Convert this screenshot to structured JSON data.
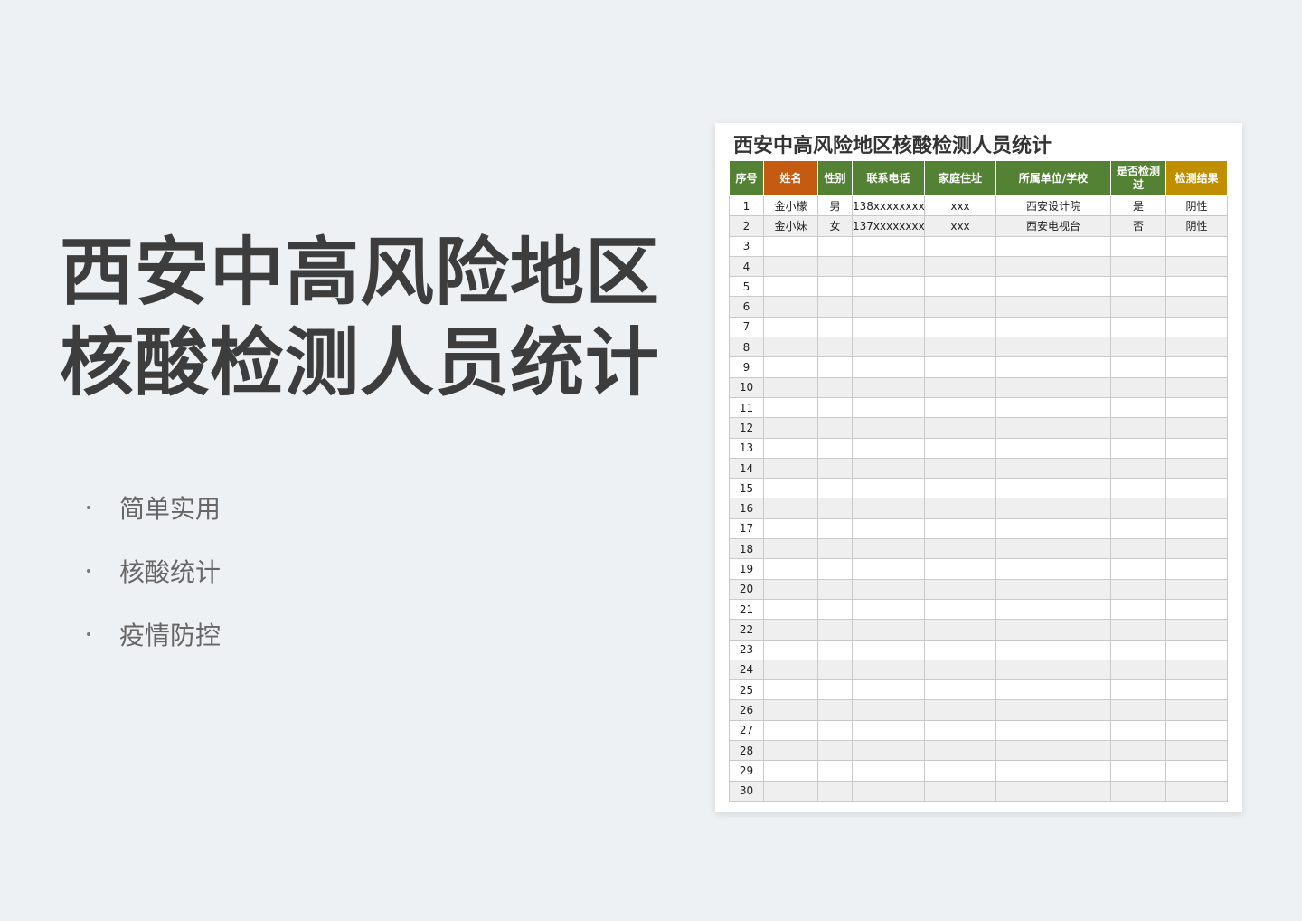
{
  "hero": {
    "line1": "西安中高风险地区",
    "line2": "核酸检测人员统计"
  },
  "features": [
    "简单实用",
    "核酸统计",
    "疫情防控"
  ],
  "sheet": {
    "title": "西安中高风险地区核酸检测人员统计",
    "headers": [
      "序号",
      "姓名",
      "性别",
      "联系电话",
      "家庭住址",
      "所属单位/学校",
      "是否检测过",
      "检测结果"
    ],
    "rows": [
      [
        "1",
        "金小檬",
        "男",
        "138xxxxxxxx",
        "xxx",
        "西安设计院",
        "是",
        "阴性"
      ],
      [
        "2",
        "金小妹",
        "女",
        "137xxxxxxxx",
        "xxx",
        "西安电视台",
        "否",
        "阴性"
      ],
      [
        "3",
        "",
        "",
        "",
        "",
        "",
        "",
        ""
      ],
      [
        "4",
        "",
        "",
        "",
        "",
        "",
        "",
        ""
      ],
      [
        "5",
        "",
        "",
        "",
        "",
        "",
        "",
        ""
      ],
      [
        "6",
        "",
        "",
        "",
        "",
        "",
        "",
        ""
      ],
      [
        "7",
        "",
        "",
        "",
        "",
        "",
        "",
        ""
      ],
      [
        "8",
        "",
        "",
        "",
        "",
        "",
        "",
        ""
      ],
      [
        "9",
        "",
        "",
        "",
        "",
        "",
        "",
        ""
      ],
      [
        "10",
        "",
        "",
        "",
        "",
        "",
        "",
        ""
      ],
      [
        "11",
        "",
        "",
        "",
        "",
        "",
        "",
        ""
      ],
      [
        "12",
        "",
        "",
        "",
        "",
        "",
        "",
        ""
      ],
      [
        "13",
        "",
        "",
        "",
        "",
        "",
        "",
        ""
      ],
      [
        "14",
        "",
        "",
        "",
        "",
        "",
        "",
        ""
      ],
      [
        "15",
        "",
        "",
        "",
        "",
        "",
        "",
        ""
      ],
      [
        "16",
        "",
        "",
        "",
        "",
        "",
        "",
        ""
      ],
      [
        "17",
        "",
        "",
        "",
        "",
        "",
        "",
        ""
      ],
      [
        "18",
        "",
        "",
        "",
        "",
        "",
        "",
        ""
      ],
      [
        "19",
        "",
        "",
        "",
        "",
        "",
        "",
        ""
      ],
      [
        "20",
        "",
        "",
        "",
        "",
        "",
        "",
        ""
      ],
      [
        "21",
        "",
        "",
        "",
        "",
        "",
        "",
        ""
      ],
      [
        "22",
        "",
        "",
        "",
        "",
        "",
        "",
        ""
      ],
      [
        "23",
        "",
        "",
        "",
        "",
        "",
        "",
        ""
      ],
      [
        "24",
        "",
        "",
        "",
        "",
        "",
        "",
        ""
      ],
      [
        "25",
        "",
        "",
        "",
        "",
        "",
        "",
        ""
      ],
      [
        "26",
        "",
        "",
        "",
        "",
        "",
        "",
        ""
      ],
      [
        "27",
        "",
        "",
        "",
        "",
        "",
        "",
        ""
      ],
      [
        "28",
        "",
        "",
        "",
        "",
        "",
        "",
        ""
      ],
      [
        "29",
        "",
        "",
        "",
        "",
        "",
        "",
        ""
      ],
      [
        "30",
        "",
        "",
        "",
        "",
        "",
        "",
        ""
      ]
    ]
  },
  "colors": {
    "header_green": "#548235",
    "header_orange": "#c55a11",
    "header_gold": "#bf8f00"
  }
}
